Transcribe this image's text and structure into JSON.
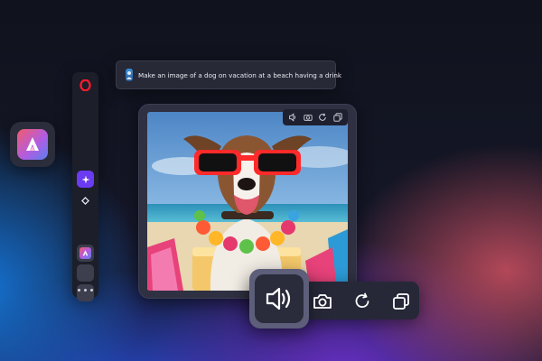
{
  "prompt": {
    "text": "Make an image of a dog on vacation at a beach having a drink"
  },
  "icons": {
    "app": "aria-app-icon",
    "sidebar": [
      "opera-icon",
      "sparkle-icon",
      "diamond-icon",
      "aria-icon",
      "blank-slot",
      "blank-slot",
      "more-icon"
    ],
    "mini_toolbar": [
      "speaker-icon",
      "camera-icon",
      "refresh-icon",
      "copy-icon"
    ],
    "big_toolbar": [
      "speaker-icon",
      "camera-icon",
      "refresh-icon",
      "copy-icon"
    ]
  },
  "colors": {
    "accent": "#6a3bf0",
    "opera_red": "#ff1b2d",
    "panel": "#1c1e29"
  }
}
